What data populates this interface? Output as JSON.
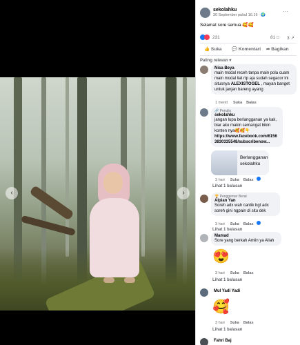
{
  "post": {
    "page_name": "sekolahku",
    "timestamp": "30 September pukul 16.16 · 🌍",
    "caption": "Selamat sore semua 🥰🥰",
    "reaction_count": "231",
    "comment_count": "81",
    "share_count": "3"
  },
  "actions": {
    "like": "Suka",
    "comment": "Komentari",
    "share": "Bagikan"
  },
  "sort_label": "Paling relevan ▾",
  "comments": [
    {
      "author": "Nisa Beya",
      "text_before": "main modal receh tanpa main pola cuam main modal liat rtp aja sudah segacor ini situsnya ",
      "text_bold": "ALEXISTOGEL",
      "text_after": " , mayan banget untuk janjan bareng ayang",
      "time": "1 menit",
      "like": "Suka",
      "reply": "Balas"
    },
    {
      "badge": "🔗 Penulis",
      "author": "sekolahku",
      "text": "jangan lupa berlangganan ya kak, biar aku makin semangat bikin konten nya🥰🥰👇",
      "link": "https://www.facebook.com/61563830335548/subscribenow...",
      "subscribe_card": "Berlangganan sekolahku",
      "time": "3 hari",
      "like": "Suka",
      "reply": "Balas",
      "replies": "Lihat 1 balasan"
    },
    {
      "badge": "🏆 Penggemar Berat",
      "author": "Alpian Yan",
      "text": "Soreh adx wah cantik bgt adx soreh gini ngpain di situ dek",
      "time": "3 hari",
      "like": "Suka",
      "reply": "Balas",
      "replies": "Lihat 1 balasan"
    },
    {
      "author": "Mamad",
      "text": "Sore yang berkah Amiin ya Allah",
      "sticker": "😍",
      "time": "3 hari",
      "like": "Suka",
      "reply": "Balas",
      "replies": "Lihat 1 balasan"
    },
    {
      "author": "Mul Yadi Yadi",
      "sticker": "🥰",
      "time": "3 hari",
      "like": "Suka",
      "reply": "Balas",
      "replies": "Lihat 1 balasan"
    },
    {
      "author": "Fahri Baj"
    }
  ],
  "nav": {
    "prev": "‹",
    "next": "›"
  },
  "icons": {
    "more": "···"
  }
}
